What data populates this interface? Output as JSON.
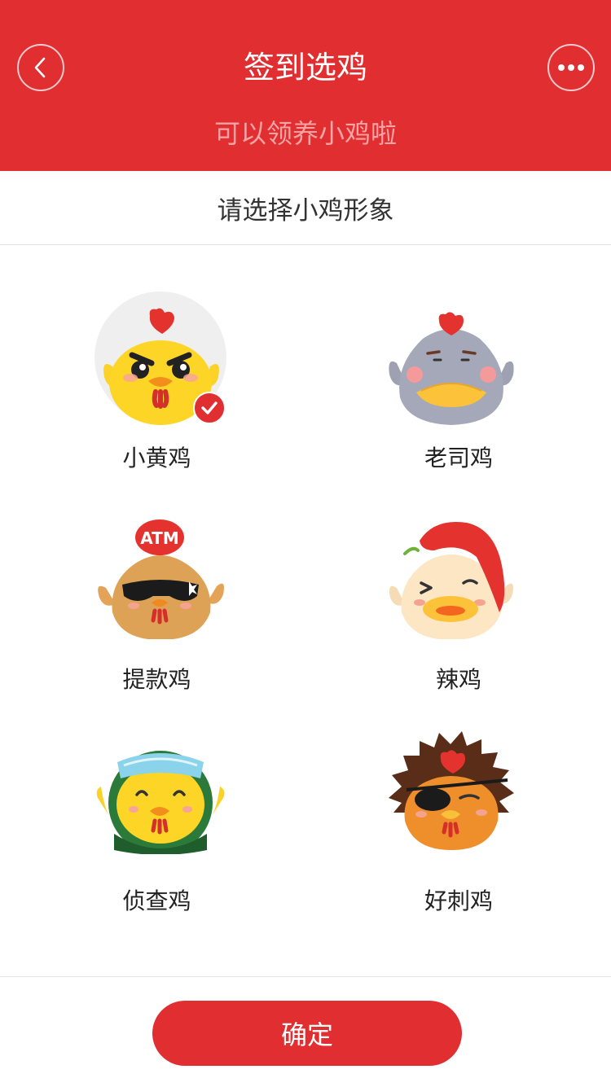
{
  "header": {
    "title": "签到选鸡",
    "subtitle": "可以领养小鸡啦",
    "back_icon": "chevron-left-icon",
    "more_icon": "more-dots-icon"
  },
  "section": {
    "title": "请选择小鸡形象"
  },
  "chickens": [
    {
      "name": "小黄鸡",
      "selected": true
    },
    {
      "name": "老司鸡",
      "selected": false
    },
    {
      "name": "提款鸡",
      "selected": false,
      "hat_text": "ATM"
    },
    {
      "name": "辣鸡",
      "selected": false
    },
    {
      "name": "侦查鸡",
      "selected": false
    },
    {
      "name": "好刺鸡",
      "selected": false
    }
  ],
  "footer": {
    "confirm_label": "确定"
  },
  "colors": {
    "brand_red": "#e02e31",
    "subtitle_pink": "#f9a3a4",
    "text_dark": "#222222"
  }
}
